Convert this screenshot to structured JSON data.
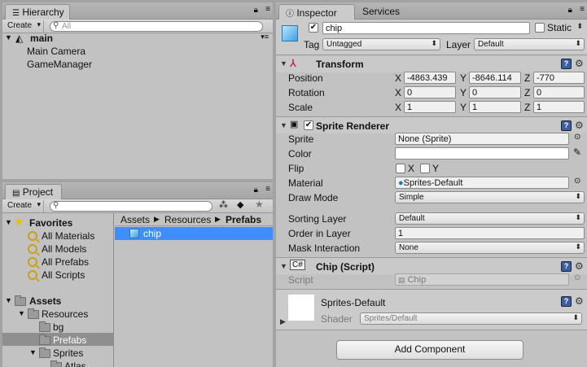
{
  "hierarchy": {
    "tab_label": "Hierarchy",
    "create_label": "Create",
    "search_placeholder": "All",
    "scene_name": "main",
    "objects": [
      "Main Camera",
      "GameManager"
    ]
  },
  "project": {
    "tab_label": "Project",
    "create_label": "Create",
    "favorites_label": "Favorites",
    "favorites": [
      "All Materials",
      "All Models",
      "All Prefabs",
      "All Scripts"
    ],
    "assets_label": "Assets",
    "tree": {
      "resources": "Resources",
      "bg": "bg",
      "prefabs": "Prefabs",
      "sprites": "Sprites",
      "atlas": "Atlas"
    },
    "breadcrumb": [
      "Assets",
      "Resources",
      "Prefabs"
    ],
    "files": [
      "chip"
    ]
  },
  "inspector": {
    "tab_label": "Inspector",
    "services_tab_label": "Services",
    "object_name": "chip",
    "static_label": "Static",
    "tag_label": "Tag",
    "tag_value": "Untagged",
    "layer_label": "Layer",
    "layer_value": "Default",
    "transform": {
      "title": "Transform",
      "position_label": "Position",
      "rotation_label": "Rotation",
      "scale_label": "Scale",
      "axis_x": "X",
      "axis_y": "Y",
      "axis_z": "Z",
      "position": [
        "-4863.439",
        "-8646.114",
        "-770"
      ],
      "rotation": [
        "0",
        "0",
        "0"
      ],
      "scale": [
        "1",
        "1",
        "1"
      ]
    },
    "sprite_renderer": {
      "title": "Sprite Renderer",
      "sprite_label": "Sprite",
      "sprite_value": "None (Sprite)",
      "color_label": "Color",
      "flip_label": "Flip",
      "flip_x": "X",
      "flip_y": "Y",
      "material_label": "Material",
      "material_value": "Sprites-Default",
      "draw_mode_label": "Draw Mode",
      "draw_mode_value": "Simple",
      "sorting_layer_label": "Sorting Layer",
      "sorting_layer_value": "Default",
      "order_label": "Order in Layer",
      "order_value": "1",
      "mask_label": "Mask Interaction",
      "mask_value": "None"
    },
    "script": {
      "title": "Chip (Script)",
      "script_label": "Script",
      "script_value": "Chip"
    },
    "material": {
      "name": "Sprites-Default",
      "shader_label": "Shader",
      "shader_value": "Sprites/Default"
    },
    "add_component_label": "Add Component"
  },
  "colors": {
    "selection": "#3f8eff",
    "panel": "#c2c2c2",
    "help_icon": "#3c5d9e"
  }
}
